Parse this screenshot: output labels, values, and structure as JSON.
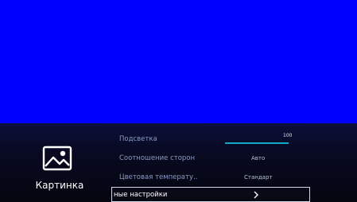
{
  "category": {
    "label": "Картинка",
    "icon": "image-icon"
  },
  "settings": [
    {
      "label": "Подсветка",
      "type": "slider",
      "value": "100",
      "level": 1.0
    },
    {
      "label": "Соотношение сторон",
      "type": "option",
      "value": "Авто"
    },
    {
      "label": "Цветовая температу..",
      "type": "option",
      "value": "Стандарт"
    },
    {
      "label": "ные настройки",
      "type": "submenu",
      "icon": "chevron-right-icon",
      "selected": true
    }
  ],
  "colors": {
    "background_video": "#0000ff",
    "slider_fill": "#14a7c8",
    "slider_track": "#1d3c5e"
  }
}
